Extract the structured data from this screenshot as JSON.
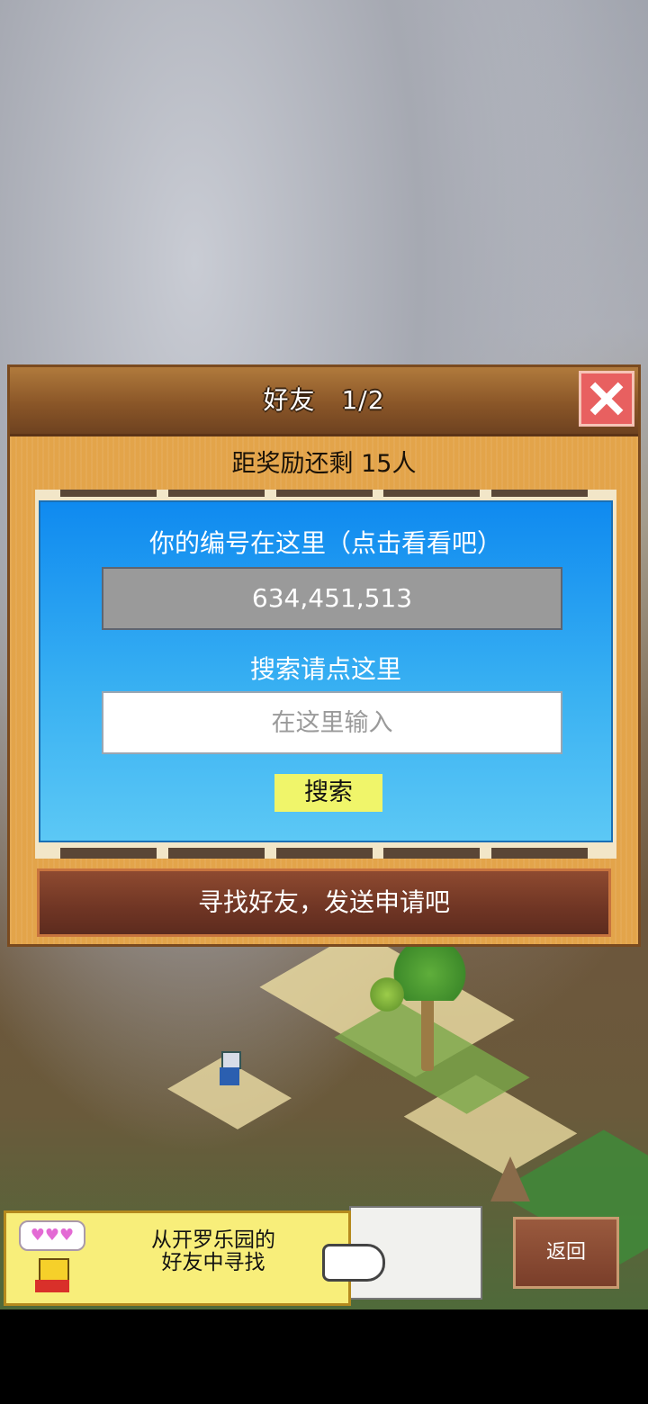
{
  "dialog": {
    "title": "好友　1/2",
    "reward_text": "距奖励还剩 15人",
    "id_caption": "你的编号在这里（点击看看吧）",
    "player_id": "634,451,513",
    "search_caption": "搜索请点这里",
    "search_placeholder": "在这里输入",
    "search_button": "搜索",
    "find_friends_button": "寻找好友，发送申请吧"
  },
  "hint": {
    "text_line1": "从开罗乐园的",
    "text_line2": "好友中寻找",
    "bubble": "♥♥♥"
  },
  "back_button": "返回",
  "colors": {
    "dialog_bg": "#e3a44a",
    "panel_blue": "#0f8af0",
    "search_button_bg": "#f0f56a",
    "close_button": "#e86060"
  }
}
